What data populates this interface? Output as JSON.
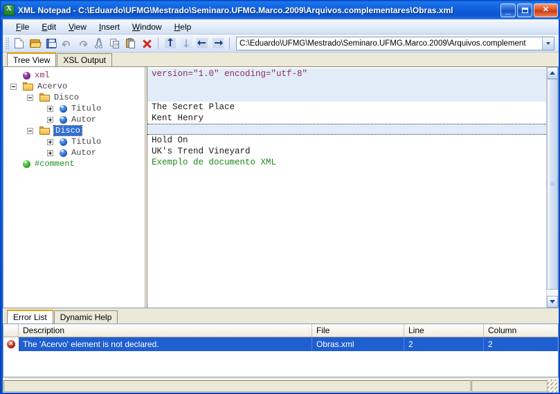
{
  "window": {
    "title": "XML Notepad - C:\\Eduardo\\UFMG\\Mestrado\\Seminaro.UFMG.Marco.2009\\Arquivos.complementares\\Obras.xml",
    "app_icon": "xml-notepad-icon",
    "controls": {
      "minimize": "minimize-button",
      "maximize": "maximize-button",
      "close": "close-button",
      "close_glyph": "✕",
      "minimize_glyph": "_"
    }
  },
  "menubar": {
    "items": [
      {
        "label": "File",
        "mnemonic": "F"
      },
      {
        "label": "Edit",
        "mnemonic": "E"
      },
      {
        "label": "View",
        "mnemonic": "V"
      },
      {
        "label": "Insert",
        "mnemonic": "I"
      },
      {
        "label": "Window",
        "mnemonic": "W"
      },
      {
        "label": "Help",
        "mnemonic": "H"
      }
    ]
  },
  "toolbar": {
    "buttons": [
      {
        "name": "new-icon",
        "tooltip": "New"
      },
      {
        "name": "open-folder-icon",
        "tooltip": "Open"
      },
      {
        "name": "save-icon",
        "tooltip": "Save"
      },
      {
        "name": "undo-icon",
        "tooltip": "Undo"
      },
      {
        "name": "redo-icon",
        "tooltip": "Redo"
      },
      {
        "name": "cut-scissors-icon",
        "tooltip": "Cut"
      },
      {
        "name": "copy-icon",
        "tooltip": "Copy"
      },
      {
        "name": "paste-icon",
        "tooltip": "Paste"
      },
      {
        "name": "delete-x-icon",
        "tooltip": "Delete"
      },
      {
        "name": "move-node-up-icon",
        "tooltip": "Move Up"
      },
      {
        "name": "move-node-down-icon",
        "tooltip": "Move Down"
      },
      {
        "name": "promote-node-icon",
        "tooltip": "Promote"
      },
      {
        "name": "demote-node-icon",
        "tooltip": "Demote"
      }
    ]
  },
  "address": {
    "value": "C:\\Eduardo\\UFMG\\Mestrado\\Seminaro.UFMG.Marco.2009\\Arquivos.complement",
    "placeholder": "",
    "dropdown_icon": "chevron-down-icon"
  },
  "main_tabs": {
    "items": [
      {
        "label": "Tree View",
        "active": true
      },
      {
        "label": "XSL Output",
        "active": false
      }
    ]
  },
  "tree": {
    "nodes": [
      {
        "label": "xml",
        "icon": "purple-orb-icon",
        "indent": 1,
        "expander": "none",
        "style": "xmlname",
        "selected": false
      },
      {
        "label": "Acervo",
        "icon": "folder-icon",
        "indent": 0,
        "expander": "minus",
        "style": "plain",
        "selected": false
      },
      {
        "label": "Disco",
        "icon": "folder-icon",
        "indent": 1,
        "expander": "minus",
        "style": "plain",
        "selected": false
      },
      {
        "label": "Titulo",
        "icon": "blue-orb-icon",
        "indent": 2,
        "expander": "plus",
        "style": "plain",
        "selected": false
      },
      {
        "label": "Autor",
        "icon": "blue-orb-icon",
        "indent": 2,
        "expander": "plus",
        "style": "plain",
        "selected": false
      },
      {
        "label": "Disco",
        "icon": "folder-icon",
        "indent": 1,
        "expander": "minus",
        "style": "plain",
        "selected": true
      },
      {
        "label": "Titulo",
        "icon": "blue-orb-icon",
        "indent": 2,
        "expander": "plus",
        "style": "plain",
        "selected": false
      },
      {
        "label": "Autor",
        "icon": "blue-orb-icon",
        "indent": 2,
        "expander": "plus",
        "style": "plain",
        "selected": false
      },
      {
        "label": "#comment",
        "icon": "green-orb-icon",
        "indent": 1,
        "expander": "none",
        "style": "comment",
        "selected": false
      }
    ]
  },
  "xml_rows": [
    {
      "text": "version=\"1.0\" encoding=\"utf-8\"",
      "style": "attr",
      "band": true,
      "dotted": false
    },
    {
      "text": "",
      "style": "text",
      "band": true,
      "dotted": false
    },
    {
      "text": "",
      "style": "text",
      "band": true,
      "dotted": false
    },
    {
      "text": "The Secret Place",
      "style": "text",
      "band": false,
      "dotted": false
    },
    {
      "text": "Kent Henry",
      "style": "text",
      "band": false,
      "dotted": false
    },
    {
      "text": "",
      "style": "text",
      "band": false,
      "dotted": true
    },
    {
      "text": "Hold On",
      "style": "text",
      "band": false,
      "dotted": false
    },
    {
      "text": "UK's Trend Vineyard",
      "style": "text",
      "band": false,
      "dotted": false
    },
    {
      "text": "Exemplo de documento XML",
      "style": "comment",
      "band": false,
      "dotted": false
    }
  ],
  "scrollbar": {
    "up_icon": "scroll-up-arrow-icon",
    "down_icon": "scroll-down-arrow-icon",
    "thumb": "scrollbar-thumb"
  },
  "bottom_tabs": {
    "items": [
      {
        "label": "Error List",
        "active": true
      },
      {
        "label": "Dynamic Help",
        "active": false
      }
    ]
  },
  "error_list": {
    "columns": [
      "Description",
      "File",
      "Line",
      "Column"
    ],
    "rows": [
      {
        "icon": "error-icon",
        "description": "The 'Acervo' element is not declared.",
        "file": "Obras.xml",
        "line": "2",
        "column": "2",
        "selected": true
      }
    ]
  },
  "statusbar": {
    "main": "",
    "extra": "",
    "grip": "resize-grip-icon"
  },
  "colors": {
    "title_blue": "#0d5bd8",
    "selection_blue": "#1f5fd0",
    "tab_accent_orange": "#f0a000",
    "xml_attr_purple": "#8a2f5e",
    "comment_green": "#1d8a1d",
    "face": "#ece9d8"
  }
}
